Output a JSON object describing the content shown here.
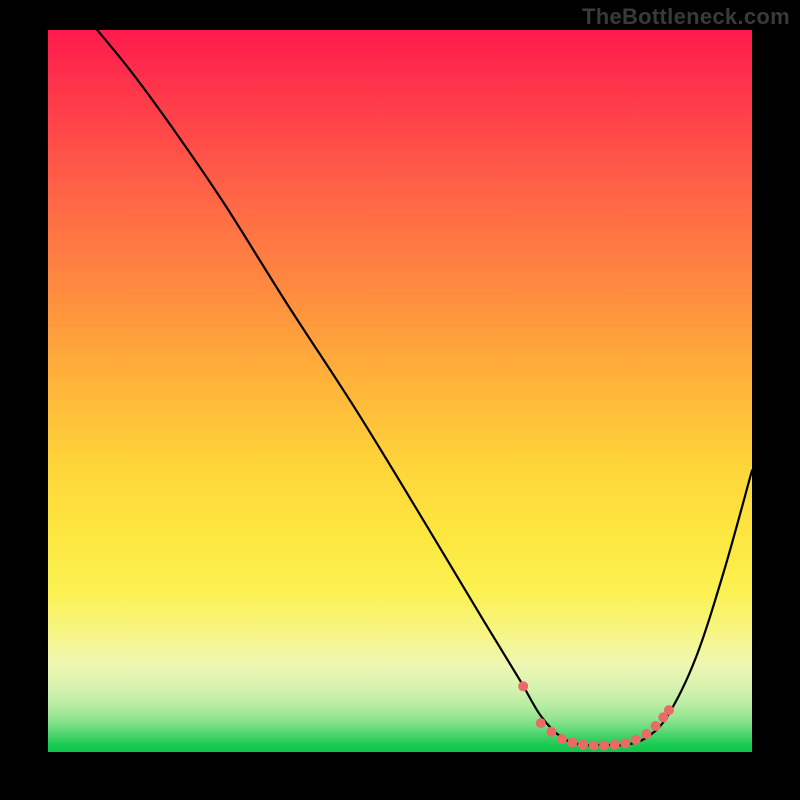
{
  "watermark": "TheBottleneck.com",
  "chart_data": {
    "type": "line",
    "title": "",
    "xlabel": "",
    "ylabel": "",
    "xlim": [
      0,
      100
    ],
    "ylim": [
      0,
      100
    ],
    "gradient_stops": [
      {
        "pct": 0,
        "color": "#ff1a4d"
      },
      {
        "pct": 50,
        "color": "#ffc23a"
      },
      {
        "pct": 80,
        "color": "#faf269"
      },
      {
        "pct": 100,
        "color": "#0fc549"
      }
    ],
    "series": [
      {
        "name": "bottleneck-curve",
        "color": "#000000",
        "x": [
          7,
          12,
          18,
          25,
          34,
          44,
          54,
          62,
          67,
          70,
          73,
          76,
          79,
          82,
          85,
          88,
          92,
          96,
          100
        ],
        "y": [
          100,
          94,
          86,
          76,
          62,
          47,
          31,
          18,
          10,
          5,
          2,
          1,
          1,
          1,
          2,
          5,
          13,
          25,
          39
        ]
      }
    ],
    "markers": {
      "name": "optimal-zone",
      "color": "#ea6a66",
      "radius": 5,
      "x": [
        67.5,
        70,
        71.5,
        73,
        74.5,
        76,
        77.5,
        79,
        80.5,
        82,
        83.5,
        85,
        86.3,
        87.4,
        88.2
      ],
      "y": [
        9.1,
        4.0,
        2.8,
        1.8,
        1.3,
        1.0,
        0.9,
        0.9,
        1.0,
        1.2,
        1.7,
        2.5,
        3.6,
        4.8,
        5.8
      ]
    }
  }
}
